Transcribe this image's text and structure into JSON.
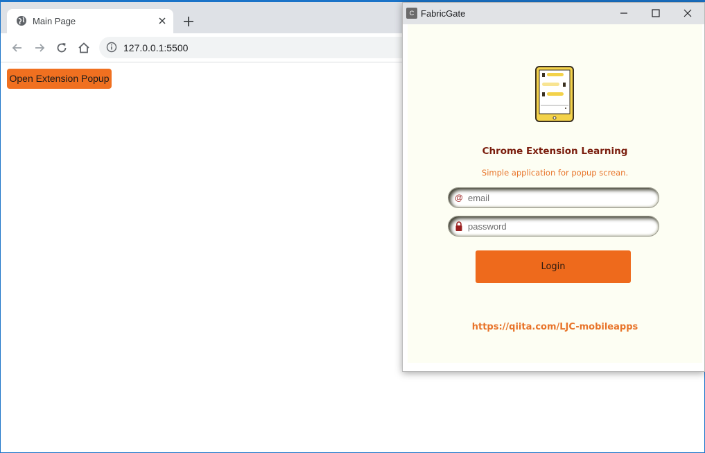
{
  "browser": {
    "tab": {
      "title": "Main Page",
      "icon": "globe-icon"
    },
    "address_bar": {
      "url": "127.0.0.1:5500"
    }
  },
  "page": {
    "open_button_label": "Open Extension Popup",
    "open_button_color": "#f07020"
  },
  "popup": {
    "window_title": "FabricGate",
    "favicon_letter": "C",
    "app_title": "Chrome Extension Learning",
    "app_subtitle": "Simple application for popup screan.",
    "email": {
      "placeholder": "email",
      "value": "",
      "icon": "at-sign-icon"
    },
    "password": {
      "placeholder": "password",
      "value": "",
      "icon": "lock-icon"
    },
    "login_label": "Login",
    "link_text": "https://qiita.com/LJC-mobileapps",
    "colors": {
      "background": "#fdfef3",
      "accent": "#ee6a1c",
      "title": "#7a1d0d"
    }
  }
}
